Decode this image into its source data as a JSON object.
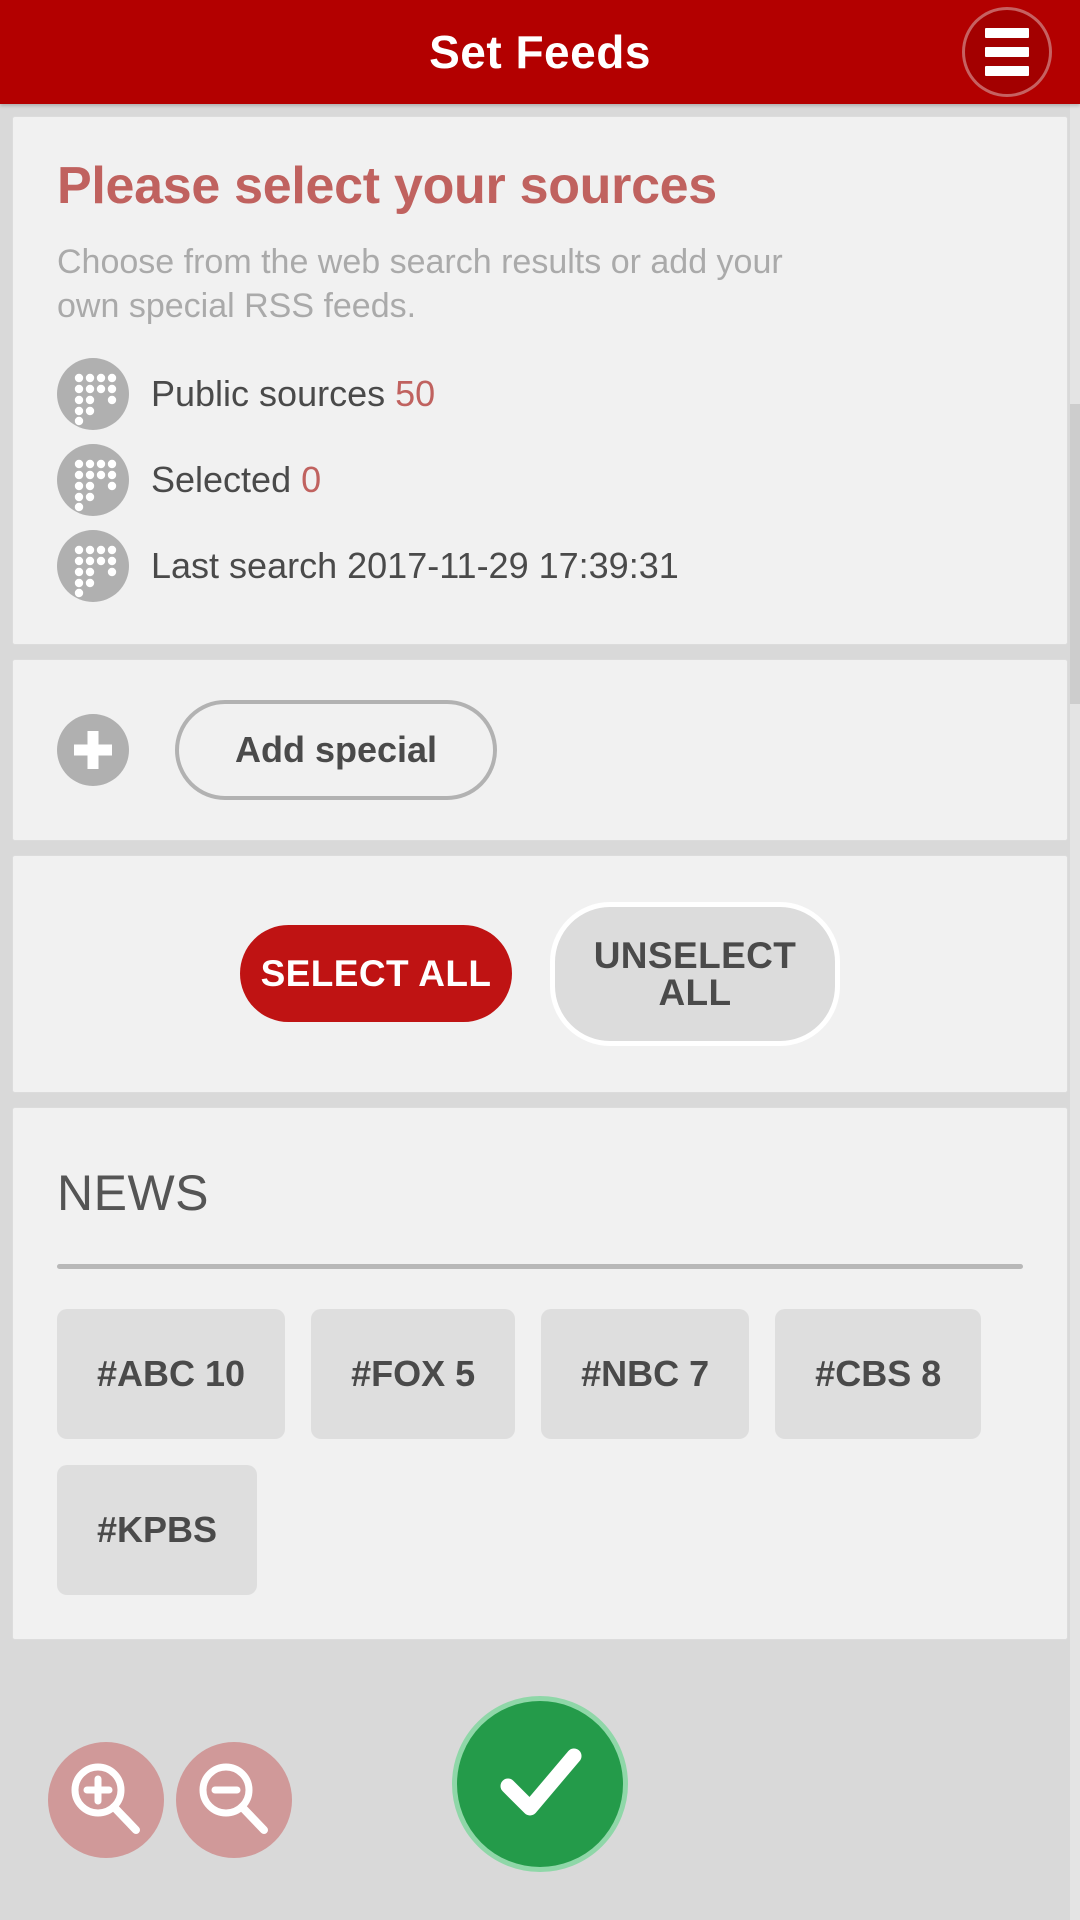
{
  "appbar": {
    "title": "Set Feeds",
    "menu_icon": "hamburger-menu-icon"
  },
  "intro_card": {
    "headline": "Please select your sources",
    "subtext": "Choose from the web search results or add your own special RSS feeds.",
    "rows": [
      {
        "icon": "dots-grid-icon",
        "label": "Public sources",
        "value": "50",
        "value_style": "accent"
      },
      {
        "icon": "dots-grid-icon",
        "label": "Selected",
        "value": "0",
        "value_style": "accent"
      },
      {
        "icon": "dots-grid-icon",
        "label": "Last search",
        "value": "2017-11-29 17:39:31",
        "value_style": "plain"
      }
    ]
  },
  "add_card": {
    "plus_icon": "plus-circle-icon",
    "button_label": "Add special"
  },
  "actions_card": {
    "select_all_label": "SELECT ALL",
    "unselect_all_label": "UNSELECT ALL"
  },
  "news_card": {
    "title": "NEWS",
    "chips": [
      {
        "label": "#ABC 10"
      },
      {
        "label": "#FOX 5"
      },
      {
        "label": "#NBC 7"
      },
      {
        "label": "#CBS 8"
      },
      {
        "label": "#KPBS"
      }
    ]
  },
  "floating": {
    "zoom_in_icon": "zoom-in-icon",
    "zoom_out_icon": "zoom-out-icon",
    "confirm_icon": "checkmark-icon"
  },
  "colors": {
    "brand_red": "#b30000",
    "accent_red": "#bf1313",
    "headline_red": "#c0625f",
    "confirm_green": "#249b4a",
    "page_bg": "#d9d9d9",
    "card_bg": "#f1f1f1",
    "chip_bg": "#dedede"
  }
}
